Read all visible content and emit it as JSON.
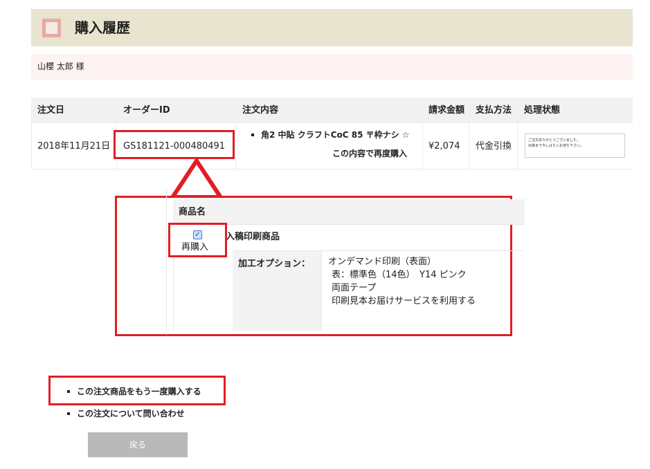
{
  "page": {
    "title": "購入履歴",
    "customer_name": "山櫻 太郎 様"
  },
  "order_table": {
    "headers": {
      "date": "注文日",
      "order_id": "オーダーID",
      "content": "注文内容",
      "amount": "請求金額",
      "payment": "支払方法",
      "status": "処理状態"
    },
    "row": {
      "date": "2018年11月21日",
      "order_id": "GS181121-000480491",
      "item": "角2 中貼 クラフトCoC 85 〒枠ナシ ☆",
      "reorder_link": "この内容で再度購入",
      "amount": "¥2,074",
      "payment": "代金引換",
      "status_line1": "ご注文ありがとうございました。",
      "status_line2": "出荷まで今しばらくお待ち下さい。"
    }
  },
  "detail_panel": {
    "header": "商品名",
    "product_name": "入稿印刷商品",
    "rebuy_label": "再購入",
    "rebuy_checked": true,
    "option_label": "加工オプション：",
    "options": [
      "オンデマンド印刷（表面）",
      "表：標準色（14色）　Y14 ピンク",
      "両面テープ",
      "印刷見本お届けサービスを利用する"
    ]
  },
  "links": {
    "reorder_all": "この注文商品をもう一度購入する",
    "inquiry": "この注文について問い合わせ"
  },
  "back_button": "戻る",
  "colors": {
    "header_bg": "#e8e4cf",
    "customer_bg": "#fdf3f3",
    "highlight_red": "#e21d24",
    "button_gray": "#b9b9b9"
  }
}
